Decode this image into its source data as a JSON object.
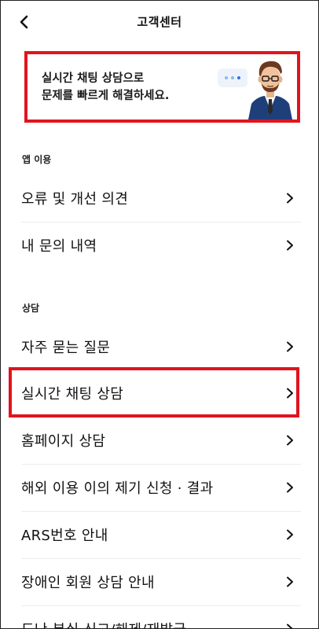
{
  "header": {
    "title": "고객센터",
    "back_icon": "chevron-left-icon"
  },
  "banner": {
    "line1": "실시간 채팅 상담으로",
    "line2": "문제를 빠르게 해결하세요.",
    "illustration": "support-agent-avatar",
    "accent_color": "#e0141e"
  },
  "sections": [
    {
      "label": "앱 이용",
      "items": [
        {
          "label": "오류 및 개선 의견"
        },
        {
          "label": "내 문의 내역"
        }
      ]
    },
    {
      "label": "상담",
      "items": [
        {
          "label": "자주 묻는 질문"
        },
        {
          "label": "실시간 채팅 상담"
        },
        {
          "label": "홈페이지 상담"
        },
        {
          "label": "해외 이용 이의 제기 신청 · 결과"
        },
        {
          "label": "ARS번호 안내"
        },
        {
          "label": "장애인 회원 상담 안내"
        },
        {
          "label": "도난·분실 신고/해제/재발급"
        }
      ]
    }
  ],
  "item_icon": "chevron-right-icon"
}
